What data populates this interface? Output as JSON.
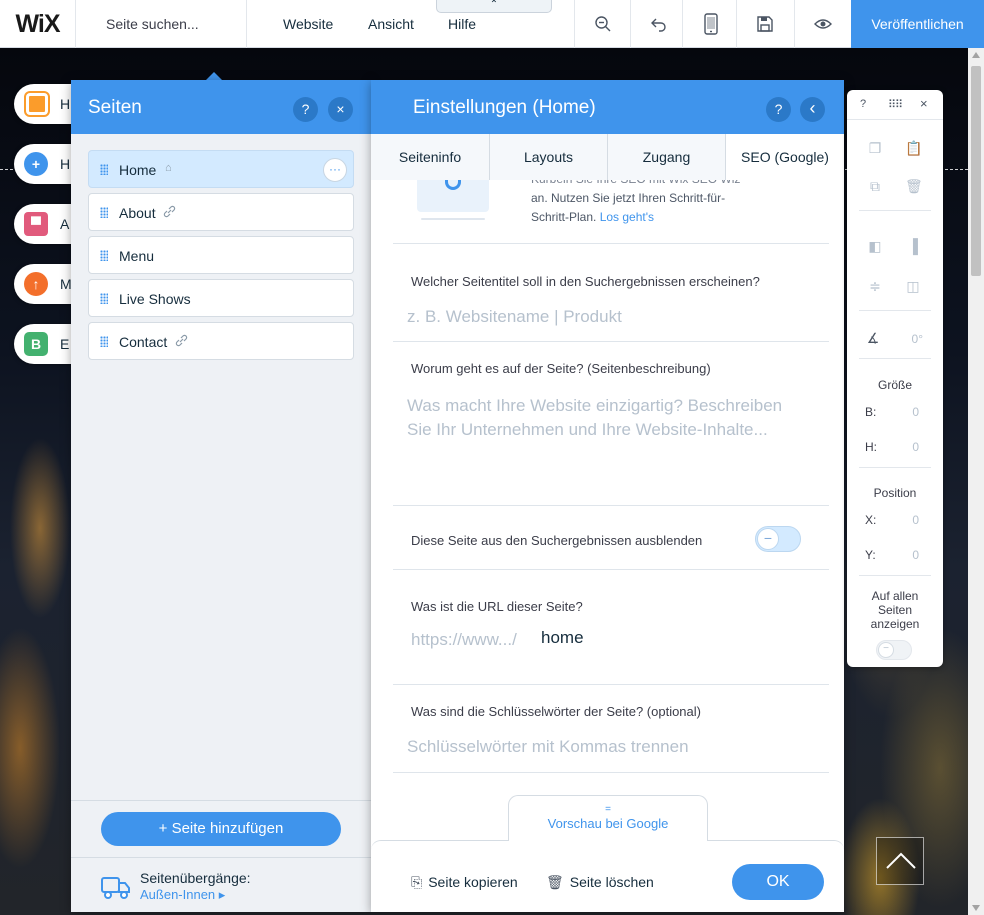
{
  "topbar": {
    "logo": "WiX",
    "search_placeholder": "Seite suchen...",
    "menu": [
      "Website",
      "Ansicht",
      "Hilfe"
    ],
    "hilfe_tab": "⌃",
    "publish": "Veröffentlichen"
  },
  "leftbar": {
    "items": [
      {
        "letter": "H",
        "color": "#fb9c2b"
      },
      {
        "letter": "H",
        "color": "#3f94ec"
      },
      {
        "letter": "A",
        "color": "#e15a7c"
      },
      {
        "letter": "M",
        "color": "#f36f2b"
      },
      {
        "letter": "E",
        "color": "#43b16f",
        "badge": "B"
      }
    ]
  },
  "pages_panel": {
    "title": "Seiten",
    "help": "?",
    "close": "×",
    "pages": [
      {
        "label": "Home",
        "icon": "⌂",
        "selected": true,
        "more": "···"
      },
      {
        "label": "About",
        "icon": "🔗"
      },
      {
        "label": "Menu"
      },
      {
        "label": "Live Shows"
      },
      {
        "label": "Contact",
        "icon": "🔗"
      }
    ],
    "add_page": "+ Seite hinzufügen",
    "transitions_title": "Seitenübergänge:",
    "transitions_link": "Außen-Innen ▸"
  },
  "settings": {
    "title": "Einstellungen (Home)",
    "help": "?",
    "back": "‹",
    "tabs": [
      "Seiteninfo",
      "Layouts",
      "Zugang",
      "SEO (Google)"
    ],
    "promo_line1": "Kurbeln Sie Ihre SEO mit Wix SEO Wiz",
    "promo_line2": "an. Nutzen Sie jetzt Ihren Schritt-für-",
    "promo_line3": "Schritt-Plan.",
    "promo_link": "Los geht's",
    "title_question": "Welcher Seitentitel soll in den Suchergebnissen erscheinen?",
    "title_placeholder": "z. B. Websitename | Produkt",
    "desc_question": "Worum geht es auf der Seite? (Seitenbeschreibung)",
    "desc_placeholder": "Was macht Ihre Website einzigartig? Beschreiben Sie Ihr Unternehmen und Ihre Website-Inhalte...",
    "hide_label": "Diese Seite aus den Suchergebnissen ausblenden",
    "hide_toggle_on": false,
    "url_question": "Was ist die URL dieser Seite?",
    "url_prefix": "https://www.../",
    "url_slug": "home",
    "keywords_question": "Was sind die Schlüsselwörter der Seite? (optional)",
    "keywords_placeholder": "Schlüsselwörter mit Kommas trennen",
    "preview_grip": "=",
    "preview_label": "Vorschau bei Google",
    "copy_page": "Seite kopieren",
    "delete_page": "Seite löschen",
    "ok": "OK"
  },
  "inspector": {
    "help": "?",
    "close": "×",
    "angle": "0°",
    "size_heading": "Größe",
    "width_label": "B:",
    "width_value": "0",
    "height_label": "H:",
    "height_value": "0",
    "position_heading": "Position",
    "x_label": "X:",
    "x_value": "0",
    "y_label": "Y:",
    "y_value": "0",
    "all_pages_line1": "Auf allen",
    "all_pages_line2": "Seiten",
    "all_pages_line3": "anzeigen"
  }
}
